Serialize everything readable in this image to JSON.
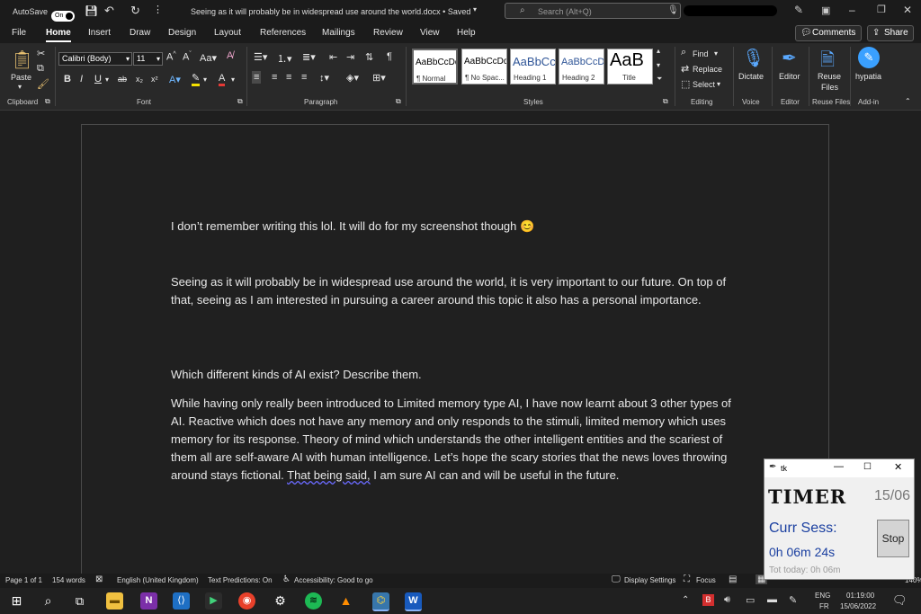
{
  "titlebar": {
    "autosave_label": "AutoSave",
    "autosave_state": "On",
    "doc_title": "Seeing as it will probably be in widespread use around the world.docx • Saved",
    "search_placeholder": "Search (Alt+Q)"
  },
  "tabs": [
    "File",
    "Home",
    "Insert",
    "Draw",
    "Design",
    "Layout",
    "References",
    "Mailings",
    "Review",
    "View",
    "Help"
  ],
  "active_tab": "Home",
  "top_buttons": {
    "comments": "Comments",
    "share": "Share"
  },
  "ribbon": {
    "clipboard": {
      "paste": "Paste",
      "label": "Clipboard"
    },
    "font": {
      "name": "Calibri (Body)",
      "size": "11",
      "label": "Font"
    },
    "paragraph": {
      "label": "Paragraph"
    },
    "styles": {
      "label": "Styles",
      "items": [
        {
          "sample": "AaBbCcDd",
          "name": "¶ Normal"
        },
        {
          "sample": "AaBbCcDd",
          "name": "¶ No Spac..."
        },
        {
          "sample": "AaBbCc",
          "name": "Heading 1"
        },
        {
          "sample": "AaBbCcD",
          "name": "Heading 2"
        },
        {
          "sample": "AaB",
          "name": "Title"
        }
      ]
    },
    "editing": {
      "find": "Find",
      "replace": "Replace",
      "select": "Select",
      "label": "Editing"
    },
    "voice": {
      "dictate": "Dictate",
      "label": "Voice"
    },
    "editor": {
      "editor": "Editor",
      "label": "Editor"
    },
    "reuse": {
      "line1": "Reuse",
      "line2": "Files",
      "label": "Reuse Files"
    },
    "addin": {
      "hypatia": "hypatia",
      "label": "Add-in"
    }
  },
  "document": {
    "p1": "I don’t remember writing this lol. It will do for my screenshot though 😊",
    "p2": "Seeing as it will probably be in widespread use around the world, it is very important to our future. On top of that, seeing as I am interested in pursuing a career around this topic it also has a personal importance.",
    "p3": "Which different kinds of AI exist? Describe them.",
    "p4a": "While having only really been introduced to Limited memory type AI, I have now learnt about 3 other types of AI. Reactive which does not have any memory and only responds to the stimuli, limited memory which uses memory for its response. Theory of mind which understands the other intelligent entities and the scariest of them all are self-aware AI with human intelligence. Let’s hope the scary stories that the news loves throwing around stays fictional. ",
    "p4b": "That being said,",
    "p4c": " I am sure AI can and will be useful in the future."
  },
  "statusbar": {
    "page": "Page 1 of 1",
    "words": "154 words",
    "language": "English (United Kingdom)",
    "predictions": "Text Predictions: On",
    "accessibility": "Accessibility: Good to go",
    "display": "Display Settings",
    "focus": "Focus",
    "zoom": "140%"
  },
  "taskbar": {
    "lang1": "ENG",
    "lang2": "FR",
    "time": "01:19:00",
    "date": "15/06/2022"
  },
  "tk": {
    "title": "tk",
    "timer": "TIMER",
    "date": "15/06",
    "curr": "Curr Sess:",
    "elapsed": "0h 06m 24s",
    "stop": "Stop",
    "total": "Tot today: 0h 06m"
  }
}
